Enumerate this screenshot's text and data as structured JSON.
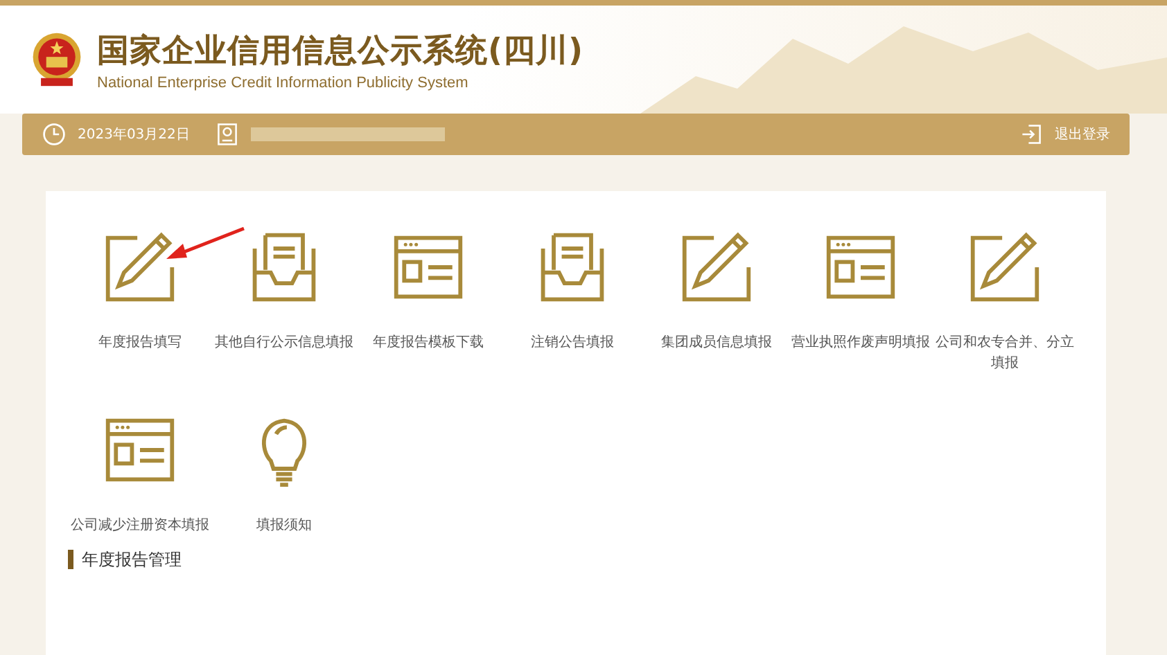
{
  "header": {
    "title": "国家企业信用信息公示系统(四川)",
    "subtitle": "National Enterprise Credit Information Publicity System"
  },
  "user_bar": {
    "date": "2023年03月22日",
    "logout": "退出登录"
  },
  "items": [
    {
      "label": "年度报告填写",
      "kind": "pencil"
    },
    {
      "label": "其他自行公示信息填报",
      "kind": "tray"
    },
    {
      "label": "年度报告模板下载",
      "kind": "window"
    },
    {
      "label": "注销公告填报",
      "kind": "tray"
    },
    {
      "label": "集团成员信息填报",
      "kind": "pencil"
    },
    {
      "label": "营业执照作废声明填报",
      "kind": "window"
    },
    {
      "label": "公司和农专合并、分立填报",
      "kind": "pencil"
    },
    {
      "label": "公司减少注册资本填报",
      "kind": "window"
    },
    {
      "label": "填报须知",
      "kind": "bulb"
    }
  ],
  "section_heading": "年度报告管理"
}
